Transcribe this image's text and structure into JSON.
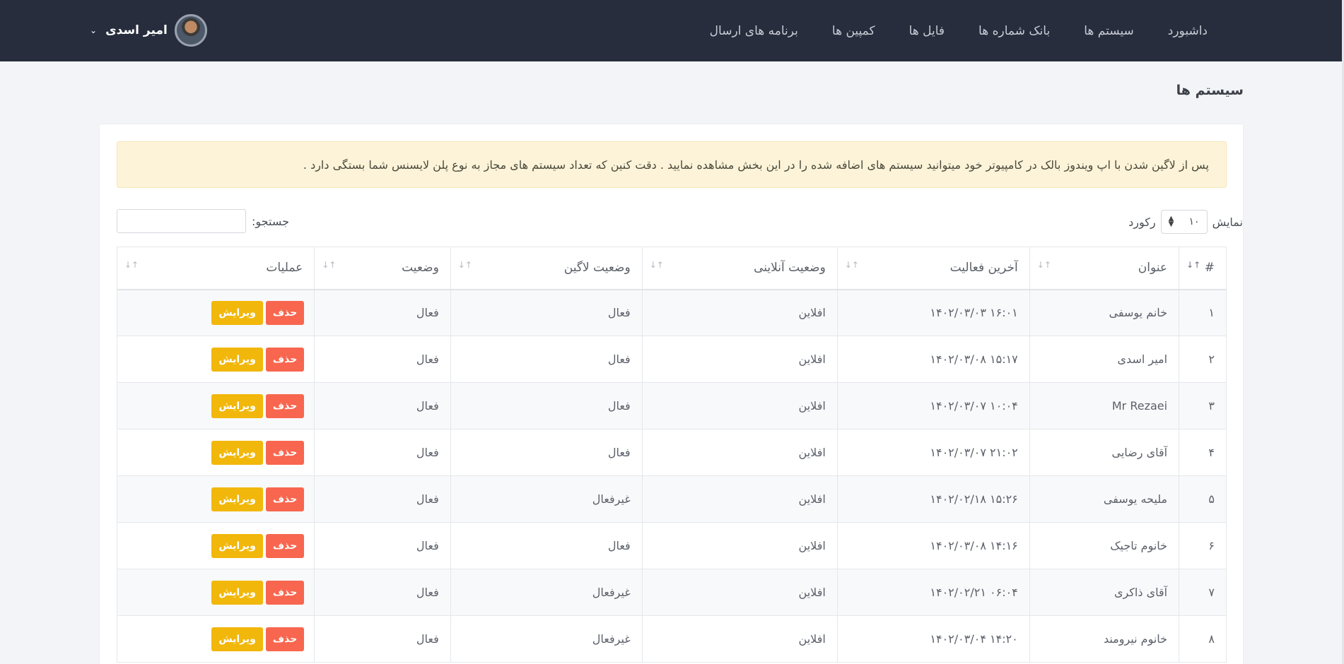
{
  "navbar": {
    "menu": [
      "داشبورد",
      "سیستم ها",
      "بانک شماره ها",
      "فایل ها",
      "کمپین ها",
      "برنامه های ارسال"
    ],
    "user_name": "امیر اسدی"
  },
  "page": {
    "title": "سیستم ها",
    "alert": "پس از لاگین شدن با اپ ویندوز بالک در کامپیوتر خود میتوانید سیستم های اضافه شده را در این بخش مشاهده نمایید . دقت کنین که تعداد سیستم های مجاز به نوع پلن لایسنس شما بستگی دارد ."
  },
  "controls": {
    "show_label": "نمایش",
    "page_length": "۱۰",
    "records_label": "رکورد",
    "search_label": "جستجو:",
    "search_value": ""
  },
  "table": {
    "headers": [
      "#",
      "عنوان",
      "آخرین فعالیت",
      "وضعیت آنلاینی",
      "وضعیت لاگین",
      "وضعیت",
      "عملیات"
    ],
    "delete_label": "حذف",
    "edit_label": "ویرایش",
    "rows": [
      {
        "num": "۱",
        "title": "خانم یوسفی",
        "last_activity": "۱۴۰۲/۰۳/۰۳ ۱۶:۰۱",
        "online": "افلاین",
        "login": "فعال",
        "status": "فعال"
      },
      {
        "num": "۲",
        "title": "امیر اسدی",
        "last_activity": "۱۴۰۲/۰۳/۰۸ ۱۵:۱۷",
        "online": "افلاین",
        "login": "فعال",
        "status": "فعال"
      },
      {
        "num": "۳",
        "title": "Mr Rezaei",
        "last_activity": "۱۴۰۲/۰۳/۰۷ ۱۰:۰۴",
        "online": "افلاین",
        "login": "فعال",
        "status": "فعال"
      },
      {
        "num": "۴",
        "title": "آقای رضایی",
        "last_activity": "۱۴۰۲/۰۳/۰۷ ۲۱:۰۲",
        "online": "افلاین",
        "login": "فعال",
        "status": "فعال"
      },
      {
        "num": "۵",
        "title": "ملیحه یوسفی",
        "last_activity": "۱۴۰۲/۰۲/۱۸ ۱۵:۲۶",
        "online": "افلاین",
        "login": "غیرفعال",
        "status": "فعال"
      },
      {
        "num": "۶",
        "title": "خانوم تاجیک",
        "last_activity": "۱۴۰۲/۰۳/۰۸ ۱۴:۱۶",
        "online": "افلاین",
        "login": "فعال",
        "status": "فعال"
      },
      {
        "num": "۷",
        "title": "آقای ذاکری",
        "last_activity": "۱۴۰۲/۰۲/۲۱ ۰۶:۰۴",
        "online": "افلاین",
        "login": "غیرفعال",
        "status": "فعال"
      },
      {
        "num": "۸",
        "title": "خانوم نیرومند",
        "last_activity": "۱۴۰۲/۰۳/۰۴ ۱۴:۲۰",
        "online": "افلاین",
        "login": "غیرفعال",
        "status": "فعال"
      }
    ]
  }
}
